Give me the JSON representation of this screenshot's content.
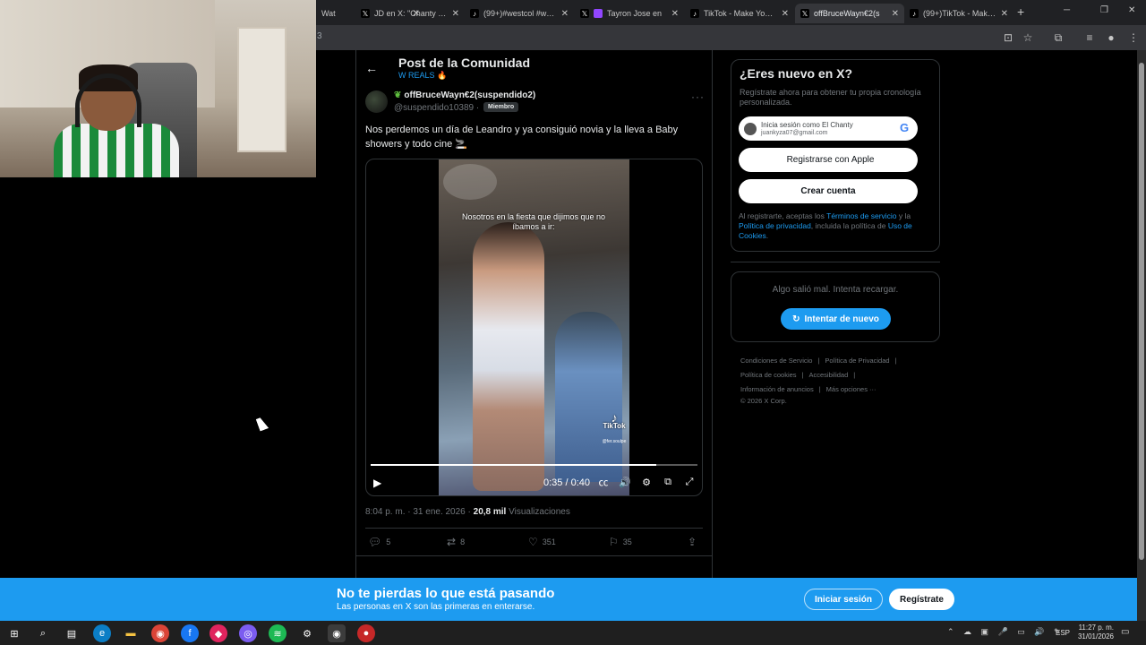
{
  "browser": {
    "tabs": [
      {
        "title": "Wat",
        "favicon": "tab-favicon",
        "color": "#202124"
      },
      {
        "title": "JD en X: \"Chanty está",
        "favicon": "x-logo",
        "color": "#000000"
      },
      {
        "title": "(99+)#westcol #west",
        "favicon": "tiktok-logo",
        "color": "#000000"
      },
      {
        "title": "Tayron Jose en",
        "favicon": "twitch-logo",
        "color": "#9146ff"
      },
      {
        "title": "TikTok - Make Your D",
        "favicon": "tiktok-logo",
        "color": "#000000"
      },
      {
        "title": "offBruceWayn€2(s",
        "favicon": "x-logo",
        "color": "#000000",
        "active": true
      },
      {
        "title": "(99+)TikTok - Make Y",
        "favicon": "tiktok-logo",
        "color": "#000000"
      }
    ],
    "url_fragment": "3"
  },
  "post": {
    "header_title": "Post de la Comunidad",
    "community": "W REALS 🔥",
    "display_name": "offBruceWayn€2(suspendido2)",
    "handle": "@suspendido10389",
    "handle_sep": "·",
    "badge": "Miembro",
    "text": "Nos perdemos un día de Leandro y ya consiguió novia y la lleva a Baby showers y todo cine 🚬",
    "video": {
      "caption": "Nosotros en la fiesta que dijimos que no íbamos a ir:",
      "watermark": "TikTok",
      "watermark_handle": "@fer.soulpe",
      "time": "0:35 / 0:40",
      "progress": 0.875
    },
    "time_posted": "8:04 p. m. · 31 ene. 2026 ·",
    "views_count": "20,8 mil",
    "views_label": "Visualizaciones",
    "actions": {
      "replies": "5",
      "reposts": "8",
      "likes": "351",
      "bookmarks": "35"
    }
  },
  "sidebar": {
    "signup_title": "¿Eres nuevo en X?",
    "signup_desc": "Regístrate ahora para obtener tu propia cronología personalizada.",
    "google_name": "Inicia sesión como El Chanty",
    "google_email": "juankyza07@gmail.com",
    "google_letter": "G",
    "apple_label": "Registrarse con Apple",
    "create_label": "Crear cuenta",
    "terms_pre": "Al registrarte, aceptas los",
    "terms_link1": "Términos de servicio",
    "terms_mid": "y la",
    "terms_link2": "Política de privacidad",
    "terms_mid2": ", incluida la política de",
    "terms_link3": "Uso de Cookies",
    "terms_end": ".",
    "error_message": "Algo salió mal. Intenta recargar.",
    "retry_label": "Intentar de nuevo",
    "footer": {
      "terms": "Condiciones de Servicio",
      "privacy": "Política de Privacidad",
      "cookies": "Política de cookies",
      "accessibility": "Accesibilidad",
      "ads": "Información de anuncios",
      "more": "Más opciones ···",
      "copyright": "© 2026 X Corp."
    }
  },
  "banner": {
    "title": "No te pierdas lo que está pasando",
    "subtitle": "Las personas en X son las primeras en enterarse.",
    "login_label": "Iniciar sesión",
    "register_label": "Regístrate"
  },
  "taskbar": {
    "lang": "ESP",
    "time": "11:27 p. m.",
    "date": "31/01/2026"
  },
  "colors": {
    "accent": "#1d9bf0",
    "background": "#000000",
    "border": "#2f3336",
    "muted": "#71767b"
  }
}
